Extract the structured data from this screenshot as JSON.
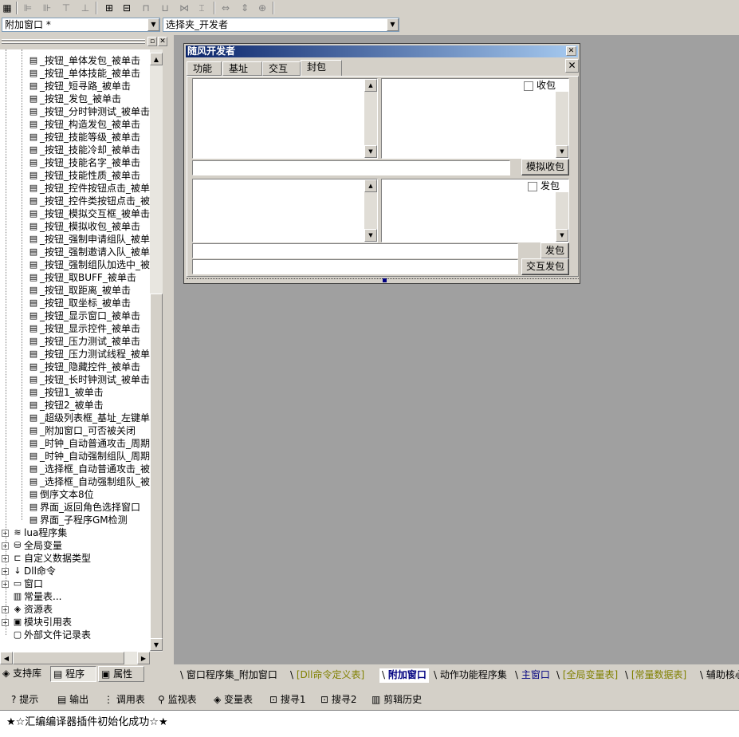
{
  "toolbar": {
    "icons": [
      "grid-icon",
      "align-left-icon",
      "align-right-icon",
      "align-top-icon",
      "align-bottom-icon",
      "center-h-icon",
      "center-v-icon",
      "same-width-icon",
      "same-height-icon",
      "space-h-icon",
      "space-v-icon",
      "size-h-icon",
      "size-v-icon",
      "size-both-icon"
    ]
  },
  "combos": {
    "window": "附加窗口 *",
    "control": "选择夹_开发者"
  },
  "tree": {
    "subs": [
      "_按钮_单体发包_被单击",
      "_按钮_单体技能_被单击",
      "_按钮_短寻路_被单击",
      "_按钮_发包_被单击",
      "_按钮_分时钟测试_被单击",
      "_按钮_构造发包_被单击",
      "_按钮_技能等级_被单击",
      "_按钮_技能冷却_被单击",
      "_按钮_技能名字_被单击",
      "_按钮_技能性质_被单击",
      "_按钮_控件按钮点击_被单击",
      "_按钮_控件类按钮点击_被单击",
      "_按钮_模拟交互框_被单击",
      "_按钮_模拟收包_被单击",
      "_按钮_强制申请组队_被单击",
      "_按钮_强制邀请入队_被单击",
      "_按钮_强制组队加选中_被单击",
      "_按钮_取BUFF_被单击",
      "_按钮_取距离_被单击",
      "_按钮_取坐标_被单击",
      "_按钮_显示窗口_被单击",
      "_按钮_显示控件_被单击",
      "_按钮_压力测试_被单击",
      "_按钮_压力测试线程_被单击",
      "_按钮_隐藏控件_被单击",
      "_按钮_长时钟测试_被单击",
      "_按钮1_被单击",
      "_按钮2_被单击",
      "_超级列表框_基址_左键单击",
      "_附加窗口_可否被关闭",
      "_时钟_自动普通攻击_周期事件",
      "_时钟_自动强制组队_周期事件",
      "_选择框_自动普通攻击_被单击",
      "_选择框_自动强制组队_被单击",
      "倒序文本8位",
      "界面_返回角色选择窗口",
      "界面_子程序GM检测"
    ],
    "roots": [
      {
        "label": "lua程序集",
        "icon": "stack-icon",
        "expander": "+"
      },
      {
        "label": "全局变量",
        "icon": "database-icon",
        "expander": "+"
      },
      {
        "label": "自定义数据类型",
        "icon": "data-type-icon",
        "expander": "+"
      },
      {
        "label": "Dll命令",
        "icon": "dll-icon",
        "expander": "+"
      },
      {
        "label": "窗口",
        "icon": "window-icon",
        "expander": "+"
      },
      {
        "label": "常量表...",
        "icon": "constants-icon",
        "expander": ""
      },
      {
        "label": "资源表",
        "icon": "resources-icon",
        "expander": "+"
      },
      {
        "label": "模块引用表",
        "icon": "module-icon",
        "expander": "+"
      },
      {
        "label": "外部文件记录表",
        "icon": "file-record-icon",
        "expander": ""
      }
    ]
  },
  "left_tabs": [
    {
      "label": "支持库",
      "icon": "library-icon"
    },
    {
      "label": "程序",
      "icon": "program-icon"
    },
    {
      "label": "属性",
      "icon": "property-icon"
    }
  ],
  "dialog": {
    "title": "随风开发者",
    "tabs": [
      "功能",
      "基址",
      "交互",
      "封包"
    ],
    "active_tab": "封包",
    "recv_check": "收包",
    "simulate_recv": "模拟收包",
    "send_check": "发包",
    "send_button": "发包",
    "interact_send": "交互发包"
  },
  "doc_tabs": [
    {
      "label": "窗口程序集_附加窗口",
      "color": "#000000",
      "active": false
    },
    {
      "label": "[Dll命令定义表]",
      "color": "#808000",
      "active": false
    },
    {
      "label": "附加窗口",
      "color": "#000080",
      "active": true
    },
    {
      "label": "动作功能程序集",
      "color": "#000000",
      "active": false
    },
    {
      "label": "主窗口",
      "color": "#000080",
      "active": false
    },
    {
      "label": "[全局变量表]",
      "color": "#808000",
      "active": false
    },
    {
      "label": "[常量数据表]",
      "color": "#808000",
      "active": false
    },
    {
      "label": "辅助核心",
      "color": "#000000",
      "active": false
    }
  ],
  "output_tabs": [
    {
      "label": "提示",
      "icon": "hint-icon"
    },
    {
      "label": "输出",
      "icon": "output-icon"
    },
    {
      "label": "调用表",
      "icon": "call-table-icon"
    },
    {
      "label": "监视表",
      "icon": "watch-icon"
    },
    {
      "label": "变量表",
      "icon": "variable-icon"
    },
    {
      "label": "搜寻1",
      "icon": "search1-icon"
    },
    {
      "label": "搜寻2",
      "icon": "search2-icon"
    },
    {
      "label": "剪辑历史",
      "icon": "clip-history-icon"
    }
  ],
  "output": {
    "message": "★☆汇编编译器插件初始化成功☆★"
  }
}
